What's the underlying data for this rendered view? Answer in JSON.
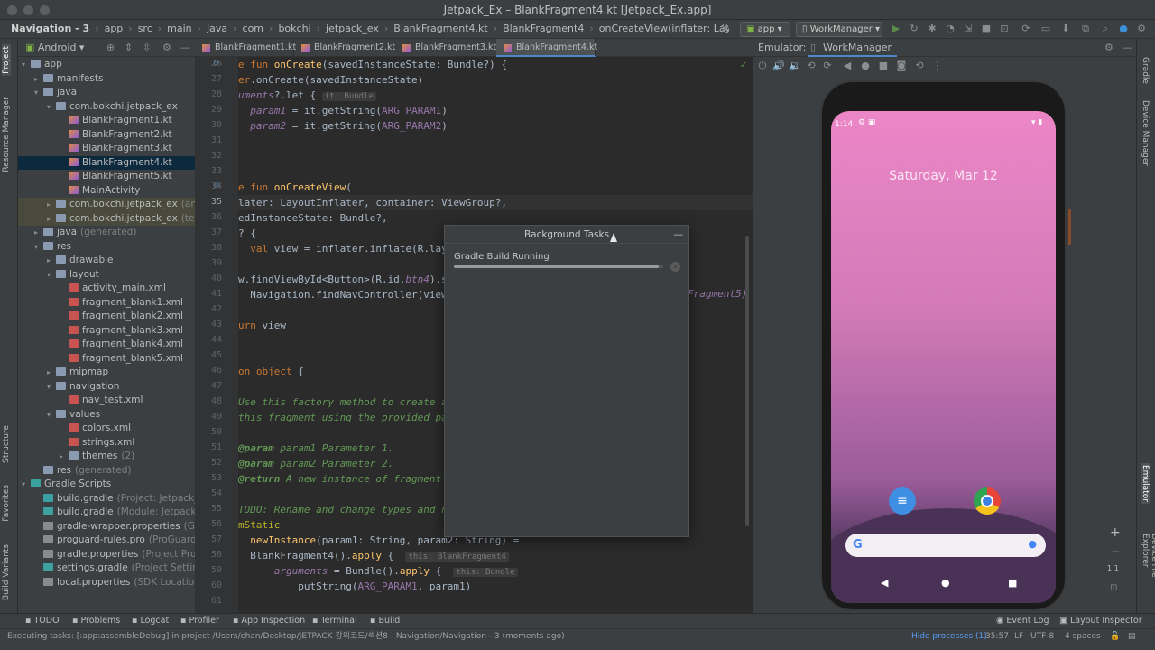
{
  "window": {
    "title": "Jetpack_Ex – BlankFragment4.kt [Jetpack_Ex.app]"
  },
  "breadcrumbs": [
    "Navigation - 3",
    "app",
    "src",
    "main",
    "java",
    "com",
    "bokchi",
    "jetpack_ex",
    "BlankFragment4.kt",
    "BlankFragment4",
    "onCreateView(inflater: LayoutInflater, containe..."
  ],
  "toolbar": {
    "run_config": "app",
    "device": "WorkManager"
  },
  "left_strip": {
    "project": "Project",
    "resource_manager": "Resource Manager",
    "structure": "Structure",
    "favorites": "Favorites",
    "build_variants": "Build Variants"
  },
  "right_strip": {
    "gradle": "Gradle",
    "device_manager": "Device Manager",
    "emulator": "Emulator",
    "device_file_explorer": "Device File Explorer"
  },
  "project": {
    "view": "Android",
    "tree": [
      {
        "depth": 0,
        "arrow": "▾",
        "label": "app",
        "icon": "folder",
        "color": "#8a9bb1"
      },
      {
        "depth": 1,
        "arrow": "▸",
        "label": "manifests",
        "icon": "folder",
        "color": "#8a9bb1"
      },
      {
        "depth": 1,
        "arrow": "▾",
        "label": "java",
        "icon": "folder",
        "color": "#8a9bb1"
      },
      {
        "depth": 2,
        "arrow": "▾",
        "label": "com.bokchi.jetpack_ex",
        "icon": "folder",
        "color": "#8a9bb1"
      },
      {
        "depth": 3,
        "arrow": "",
        "label": "BlankFragment1.kt",
        "icon": "kotlin",
        "color": "#c77b3d"
      },
      {
        "depth": 3,
        "arrow": "",
        "label": "BlankFragment2.kt",
        "icon": "kotlin",
        "color": "#c77b3d"
      },
      {
        "depth": 3,
        "arrow": "",
        "label": "BlankFragment3.kt",
        "icon": "kotlin",
        "color": "#c77b3d"
      },
      {
        "depth": 3,
        "arrow": "",
        "label": "BlankFragment4.kt",
        "icon": "kotlin",
        "color": "#c77b3d",
        "selected": true
      },
      {
        "depth": 3,
        "arrow": "",
        "label": "BlankFragment5.kt",
        "icon": "kotlin",
        "color": "#c77b3d"
      },
      {
        "depth": 3,
        "arrow": "",
        "label": "MainActivity",
        "icon": "kotlin",
        "color": "#c77b3d"
      },
      {
        "depth": 2,
        "arrow": "▸",
        "label": "com.bokchi.jetpack_ex",
        "suffix": "(andro",
        "icon": "folder",
        "color": "#8a9bb1",
        "hl": true
      },
      {
        "depth": 2,
        "arrow": "▸",
        "label": "com.bokchi.jetpack_ex",
        "suffix": "(test)",
        "icon": "folder",
        "color": "#8a9bb1",
        "hl": true
      },
      {
        "depth": 1,
        "arrow": "▸",
        "label": "java",
        "suffix": "(generated)",
        "icon": "folder",
        "color": "#8a9bb1"
      },
      {
        "depth": 1,
        "arrow": "▾",
        "label": "res",
        "icon": "folder",
        "color": "#8a9bb1"
      },
      {
        "depth": 2,
        "arrow": "▸",
        "label": "drawable",
        "icon": "folder",
        "color": "#8a9bb1"
      },
      {
        "depth": 2,
        "arrow": "▾",
        "label": "layout",
        "icon": "folder",
        "color": "#8a9bb1"
      },
      {
        "depth": 3,
        "arrow": "",
        "label": "activity_main.xml",
        "icon": "xml",
        "color": "#c75450"
      },
      {
        "depth": 3,
        "arrow": "",
        "label": "fragment_blank1.xml",
        "icon": "xml",
        "color": "#c75450"
      },
      {
        "depth": 3,
        "arrow": "",
        "label": "fragment_blank2.xml",
        "icon": "xml",
        "color": "#c75450"
      },
      {
        "depth": 3,
        "arrow": "",
        "label": "fragment_blank3.xml",
        "icon": "xml",
        "color": "#c75450"
      },
      {
        "depth": 3,
        "arrow": "",
        "label": "fragment_blank4.xml",
        "icon": "xml",
        "color": "#c75450"
      },
      {
        "depth": 3,
        "arrow": "",
        "label": "fragment_blank5.xml",
        "icon": "xml",
        "color": "#c75450"
      },
      {
        "depth": 2,
        "arrow": "▸",
        "label": "mipmap",
        "icon": "folder",
        "color": "#8a9bb1"
      },
      {
        "depth": 2,
        "arrow": "▾",
        "label": "navigation",
        "icon": "folder",
        "color": "#8a9bb1"
      },
      {
        "depth": 3,
        "arrow": "",
        "label": "nav_test.xml",
        "icon": "xml",
        "color": "#c75450"
      },
      {
        "depth": 2,
        "arrow": "▾",
        "label": "values",
        "icon": "folder",
        "color": "#8a9bb1"
      },
      {
        "depth": 3,
        "arrow": "",
        "label": "colors.xml",
        "icon": "xml",
        "color": "#c75450"
      },
      {
        "depth": 3,
        "arrow": "",
        "label": "strings.xml",
        "icon": "xml",
        "color": "#c75450"
      },
      {
        "depth": 3,
        "arrow": "▸",
        "label": "themes",
        "suffix": "(2)",
        "icon": "folder",
        "color": "#8a9bb1"
      },
      {
        "depth": 1,
        "arrow": "",
        "label": "res",
        "suffix": "(generated)",
        "icon": "folder",
        "color": "#8a9bb1"
      },
      {
        "depth": 0,
        "arrow": "▾",
        "label": "Gradle Scripts",
        "icon": "gradle",
        "color": "#3aa0a0"
      },
      {
        "depth": 1,
        "arrow": "",
        "label": "build.gradle",
        "suffix": "(Project: Jetpack_Ex",
        "icon": "gradle",
        "color": "#3aa0a0"
      },
      {
        "depth": 1,
        "arrow": "",
        "label": "build.gradle",
        "suffix": "(Module: Jetpack_Ex",
        "icon": "gradle",
        "color": "#3aa0a0"
      },
      {
        "depth": 1,
        "arrow": "",
        "label": "gradle-wrapper.properties",
        "suffix": "(Grad",
        "icon": "prop",
        "color": "#8a8a8a"
      },
      {
        "depth": 1,
        "arrow": "",
        "label": "proguard-rules.pro",
        "suffix": "(ProGuard Ru",
        "icon": "prop",
        "color": "#8a8a8a"
      },
      {
        "depth": 1,
        "arrow": "",
        "label": "gradle.properties",
        "suffix": "(Project Proper",
        "icon": "prop",
        "color": "#8a8a8a"
      },
      {
        "depth": 1,
        "arrow": "",
        "label": "settings.gradle",
        "suffix": "(Project Settings)",
        "icon": "gradle",
        "color": "#3aa0a0"
      },
      {
        "depth": 1,
        "arrow": "",
        "label": "local.properties",
        "suffix": "(SDK Location)",
        "icon": "prop",
        "color": "#8a8a8a"
      }
    ]
  },
  "editor": {
    "tabs": [
      "BlankFragment1.kt",
      "BlankFragment2.kt",
      "BlankFragment3.kt",
      "BlankFragment4.kt"
    ],
    "active_tab": 3,
    "line_numbers": [
      26,
      27,
      28,
      29,
      30,
      31,
      32,
      33,
      34,
      35,
      36,
      37,
      38,
      39,
      40,
      41,
      42,
      43,
      44,
      45,
      46,
      47,
      48,
      49,
      50,
      51,
      52,
      53,
      54,
      55,
      56,
      57,
      58,
      59,
      60,
      61
    ],
    "lines": [
      [
        [
          "kw",
          "e fun "
        ],
        [
          "fn",
          "onCreate"
        ],
        [
          "",
          "(savedInstanceState: Bundle?) {"
        ]
      ],
      [
        [
          "kw",
          "er"
        ],
        [
          "",
          ".onCreate(savedInstanceState)"
        ]
      ],
      [
        [
          "par",
          "uments"
        ],
        [
          "",
          "?.let { "
        ],
        [
          "hint",
          "it: Bundle"
        ]
      ],
      [
        [
          "",
          "  "
        ],
        [
          "par",
          "param1"
        ],
        [
          "",
          " = it.getString("
        ],
        [
          "sf",
          "ARG_PARAM1"
        ],
        [
          "",
          ")"
        ]
      ],
      [
        [
          "",
          "  "
        ],
        [
          "par",
          "param2"
        ],
        [
          "",
          " = it.getString("
        ],
        [
          "sf",
          "ARG_PARAM2"
        ],
        [
          "",
          ")"
        ]
      ],
      [
        [
          "",
          ""
        ]
      ],
      [
        [
          "",
          ""
        ]
      ],
      [
        [
          "",
          ""
        ]
      ],
      [
        [
          "kw",
          "e fun "
        ],
        [
          "fn",
          "onCreateView"
        ],
        [
          "",
          "("
        ]
      ],
      [
        [
          "",
          "later: LayoutInflater, container: ViewGroup?,"
        ]
      ],
      [
        [
          "",
          "edInstanceState: Bundle?,"
        ]
      ],
      [
        [
          "",
          "? {"
        ]
      ],
      [
        [
          "kw",
          "  val "
        ],
        [
          "",
          "view = inflater.inflate(R.layout."
        ],
        [
          "par",
          "fr"
        ]
      ],
      [
        [
          "",
          ""
        ]
      ],
      [
        [
          "",
          "w.findViewById<Button>(R.id."
        ],
        [
          "par",
          "btn4"
        ],
        [
          "",
          ").set"
        ]
      ],
      [
        [
          "",
          "  Navigation.findNavController(view).n"
        ]
      ],
      [
        [
          "",
          ""
        ]
      ],
      [
        [
          "kw",
          "urn "
        ],
        [
          "",
          "view"
        ]
      ],
      [
        [
          "",
          ""
        ]
      ],
      [
        [
          "",
          ""
        ]
      ],
      [
        [
          "kw",
          "on object "
        ],
        [
          "",
          "{"
        ]
      ],
      [
        [
          "",
          ""
        ]
      ],
      [
        [
          "cm",
          "Use this factory method to create a n"
        ]
      ],
      [
        [
          "cm",
          "this fragment using the provided para"
        ]
      ],
      [
        [
          "",
          ""
        ]
      ],
      [
        [
          "tag",
          "@param "
        ],
        [
          "cm",
          "param1 Parameter 1."
        ]
      ],
      [
        [
          "tag",
          "@param "
        ],
        [
          "cm",
          "param2 Parameter 2."
        ]
      ],
      [
        [
          "tag",
          "@return "
        ],
        [
          "cm",
          "A new instance of fragment Bl"
        ]
      ],
      [
        [
          "",
          ""
        ]
      ],
      [
        [
          "cm",
          "TODO: Rename and change types and num"
        ]
      ],
      [
        [
          "an",
          "mStatic"
        ]
      ],
      [
        [
          "fn",
          "  newInstance"
        ],
        [
          "",
          "(param1: String, param2: String) ="
        ]
      ],
      [
        [
          "",
          "  BlankFragment4()."
        ],
        [
          "fn",
          "apply"
        ],
        [
          "",
          " {  "
        ],
        [
          "hint",
          "this: BlankFragment4"
        ]
      ],
      [
        [
          "",
          "      "
        ],
        [
          "par",
          "arguments"
        ],
        [
          "",
          " = Bundle()."
        ],
        [
          "fn",
          "apply"
        ],
        [
          "",
          " {  "
        ],
        [
          "hint",
          "this: Bundle"
        ]
      ],
      [
        [
          "",
          "          putString("
        ],
        [
          "sf",
          "ARG_PARAM1"
        ],
        [
          "",
          ", param1)"
        ]
      ],
      [
        [
          "",
          ""
        ]
      ]
    ],
    "overflow_text": "Fragment5)"
  },
  "background_tasks": {
    "title": "Background Tasks",
    "task": "Gradle Build Running",
    "progress": 0.98
  },
  "emulator": {
    "label": "Emulator:",
    "device_tab": "WorkManager",
    "time": "1:14",
    "date": "Saturday, Mar 12"
  },
  "bottom_tools": [
    "TODO",
    "Problems",
    "Logcat",
    "Profiler",
    "App Inspection",
    "Terminal",
    "Build"
  ],
  "bottom_right_tools": [
    "Event Log",
    "Layout Inspector"
  ],
  "status": {
    "message": "Executing tasks: [:app:assembleDebug] in project /Users/chan/Desktop/JETPACK 강의코드/섹션8 - Navigation/Navigation - 3 (moments ago)",
    "hide_processes": "Hide processes (1)",
    "position": "35:57",
    "line_sep": "LF",
    "encoding": "UTF-8",
    "indent": "4 spaces"
  },
  "colors": {
    "accent": "#4a88c7",
    "background": "#2b2b2b",
    "panel": "#3c3f41"
  }
}
